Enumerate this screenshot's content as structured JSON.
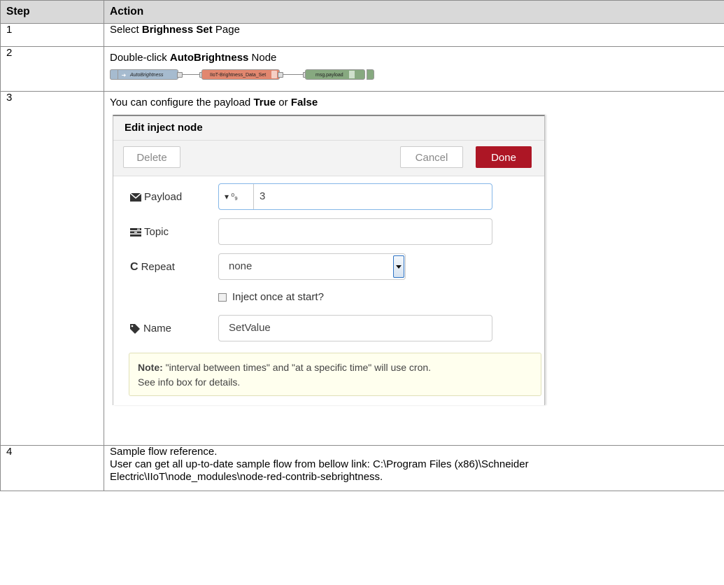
{
  "table": {
    "header": {
      "step": "Step",
      "action": "Action"
    },
    "rows": [
      {
        "step": "1",
        "pre": "Select ",
        "bold": "Brighness Set",
        "post": " Page"
      },
      {
        "step": "2",
        "pre": "Double-click ",
        "bold": "AutoBrightness",
        "post": " Node"
      },
      {
        "step": "3",
        "pre": "You can configure the payload ",
        "bold1": "True",
        "mid": " or ",
        "bold2": "False"
      },
      {
        "step": "4",
        "line1": "Sample flow reference.",
        "line2": "User can get all up-to-date sample flow from bellow link: C:\\Program Files (x86)\\Schneider",
        "line3": "Electric\\IIoT\\node_modules\\node-red-contrib-sebrightness."
      }
    ]
  },
  "flow": {
    "inject_label": "AutoBrightness",
    "function_label": "IIoT-Brightness_Data_Set",
    "debug_label": "msg.payload",
    "colors": {
      "inject": "#a6bbcf",
      "function": "#e2876f",
      "debug": "#87a980"
    }
  },
  "dialog": {
    "title": "Edit inject node",
    "delete_label": "Delete",
    "cancel_label": "Cancel",
    "done_label": "Done",
    "payload": {
      "label": "Payload",
      "type_glyph": "⁰₉",
      "value": "3"
    },
    "topic": {
      "label": "Topic",
      "value": ""
    },
    "repeat": {
      "label": "Repeat",
      "value": "none"
    },
    "inject_once_label": "Inject once at start?",
    "name": {
      "label": "Name",
      "value": "SetValue"
    },
    "note_bold": "Note:",
    "note_text": " \"interval between times\" and \"at a specific time\" will use cron.",
    "note_line2": "See info box for details.",
    "accent": "#ad1625"
  }
}
